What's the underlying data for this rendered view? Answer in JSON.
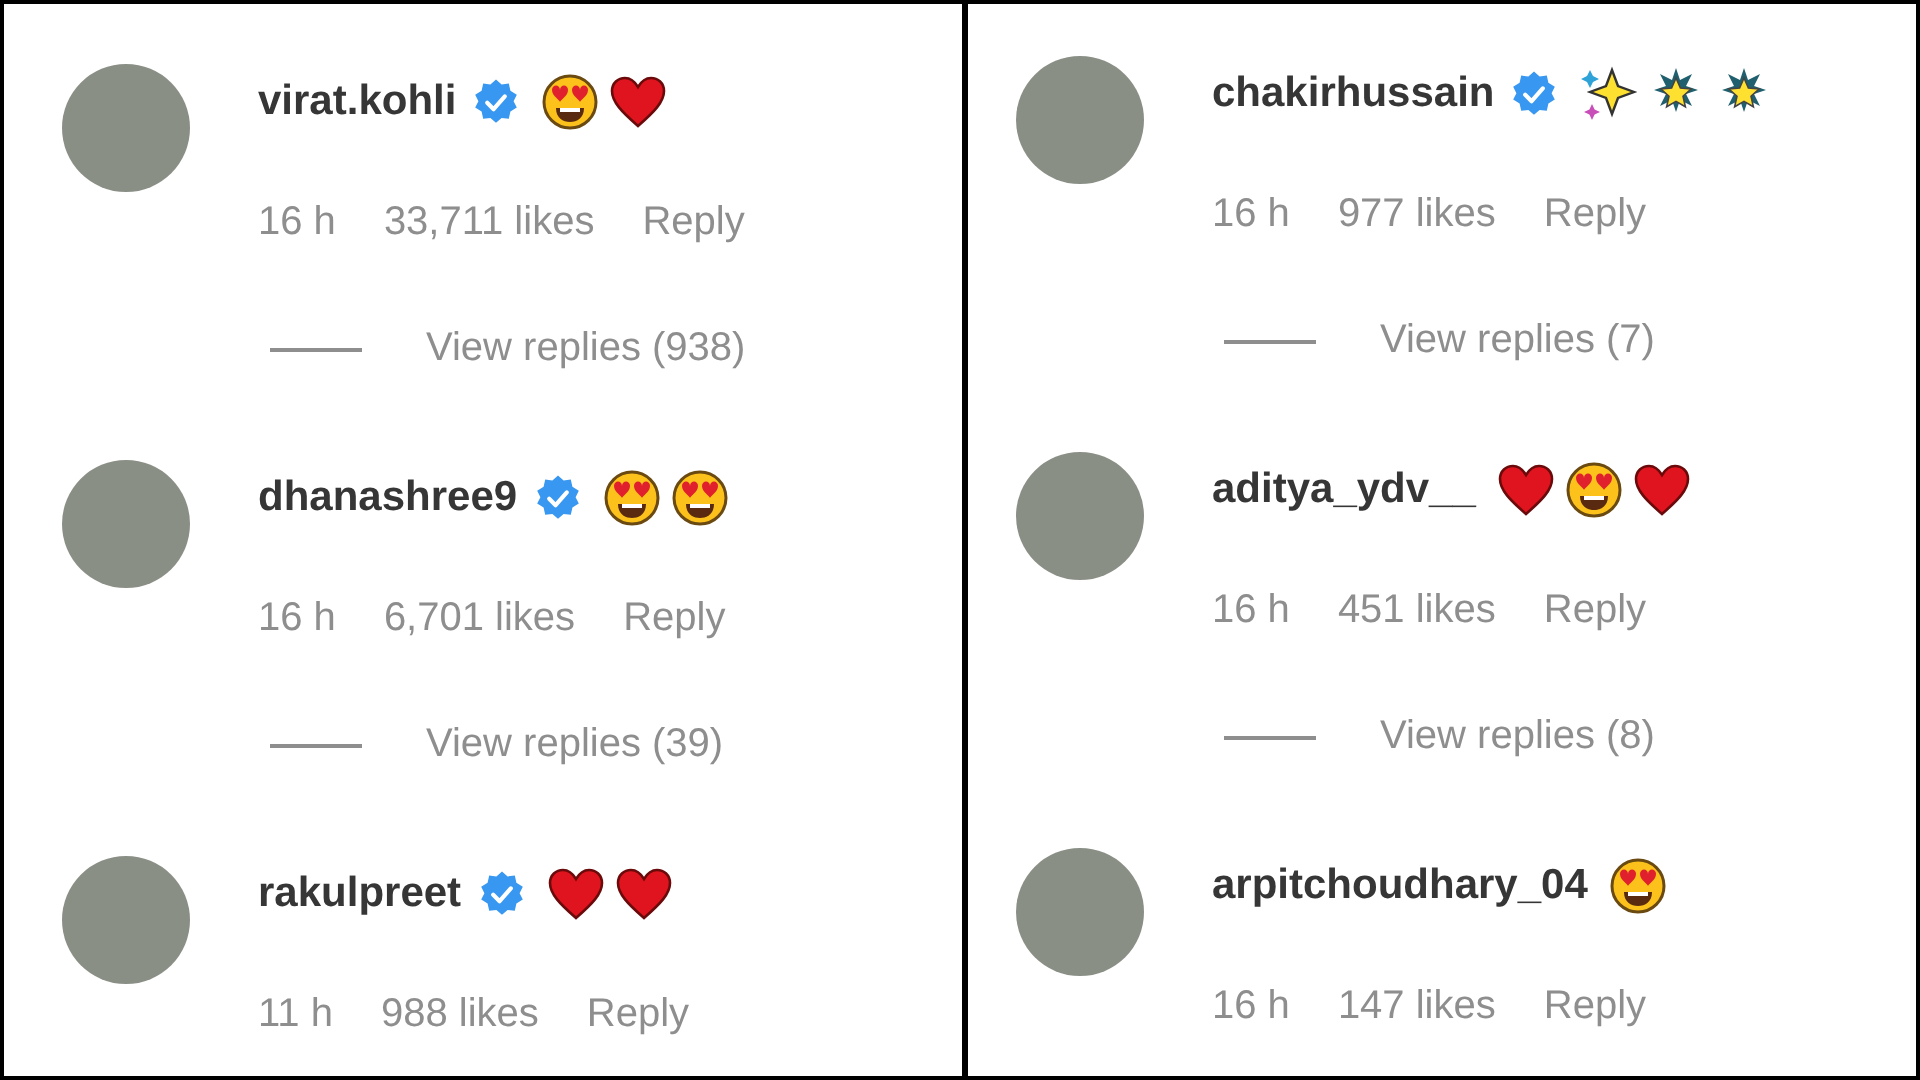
{
  "panels": [
    {
      "comments": [
        {
          "username": "virat.kohli",
          "verified": true,
          "emojis": [
            {
              "kind": "heart-eyes"
            },
            {
              "kind": "heart"
            }
          ],
          "time": "16 h",
          "likes": "33,711 likes",
          "reply": "Reply",
          "view_replies": "View replies (938)"
        },
        {
          "username": "dhanashree9",
          "verified": true,
          "emojis": [
            {
              "kind": "heart-eyes"
            },
            {
              "kind": "heart-eyes"
            }
          ],
          "time": "16 h",
          "likes": "6,701 likes",
          "reply": "Reply",
          "view_replies": "View replies (39)"
        },
        {
          "username": "rakulpreet",
          "verified": true,
          "emojis": [
            {
              "kind": "heart"
            },
            {
              "kind": "heart"
            }
          ],
          "time": "11 h",
          "likes": "988 likes",
          "reply": "Reply"
        }
      ]
    },
    {
      "comments": [
        {
          "username": "chakirhussain",
          "verified": true,
          "emojis": [
            {
              "kind": "sparkles"
            },
            {
              "kind": "star"
            },
            {
              "kind": "star"
            }
          ],
          "time": "16 h",
          "likes": "977 likes",
          "reply": "Reply",
          "view_replies": "View replies (7)"
        },
        {
          "username": "aditya_ydv__",
          "verified": false,
          "emojis": [
            {
              "kind": "heart"
            },
            {
              "kind": "heart-eyes"
            },
            {
              "kind": "heart"
            }
          ],
          "time": "16 h",
          "likes": "451 likes",
          "reply": "Reply",
          "view_replies": "View replies (8)"
        },
        {
          "username": "arpitchoudhary_04",
          "verified": false,
          "emojis": [
            {
              "kind": "heart-eyes"
            }
          ],
          "time": "16 h",
          "likes": "147 likes",
          "reply": "Reply"
        }
      ]
    }
  ]
}
